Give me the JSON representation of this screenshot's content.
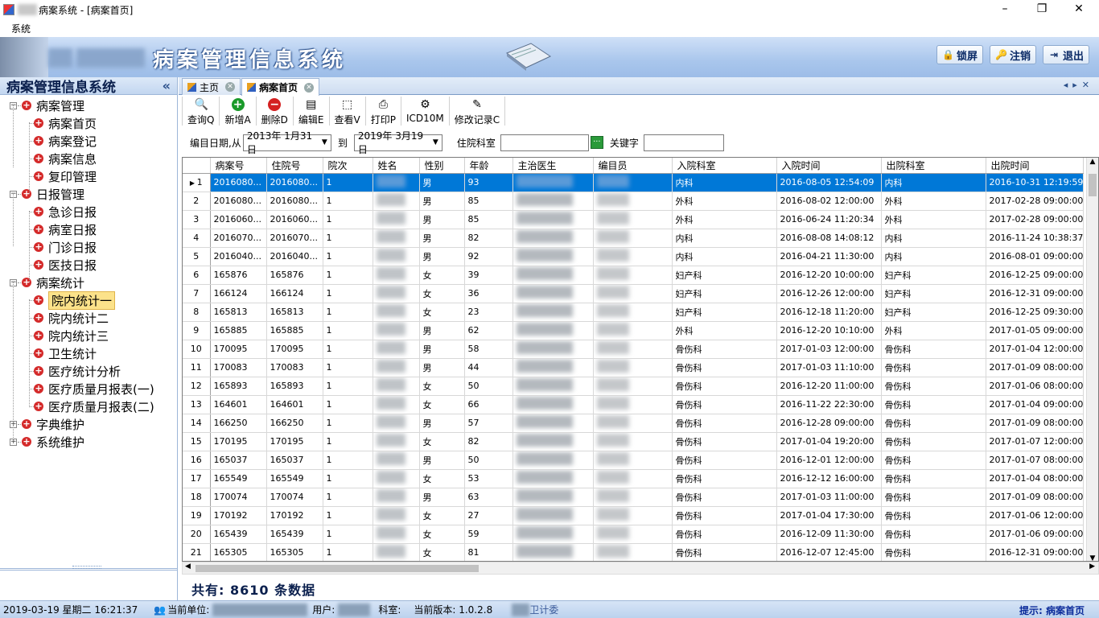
{
  "window": {
    "title": "病案系统 - [病案首页]"
  },
  "menu": [
    "系统"
  ],
  "banner": {
    "title": "病案管理信息系统",
    "buttons": [
      {
        "label": "锁屏",
        "icon": "lock-icon"
      },
      {
        "label": "注销",
        "icon": "logout-icon"
      },
      {
        "label": "退出",
        "icon": "exit-icon"
      }
    ]
  },
  "left": {
    "title": "病案管理信息系统",
    "collapse": "«",
    "tree": [
      {
        "label": "病案管理",
        "level": 0,
        "exp": "−"
      },
      {
        "label": "病案首页",
        "level": 1
      },
      {
        "label": "病案登记",
        "level": 1
      },
      {
        "label": "病案信息",
        "level": 1
      },
      {
        "label": "复印管理",
        "level": 1
      },
      {
        "label": "日报管理",
        "level": 0,
        "exp": "−"
      },
      {
        "label": "急诊日报",
        "level": 1
      },
      {
        "label": "病室日报",
        "level": 1
      },
      {
        "label": "门诊日报",
        "level": 1
      },
      {
        "label": "医技日报",
        "level": 1
      },
      {
        "label": "病案统计",
        "level": 0,
        "exp": "−"
      },
      {
        "label": "院内统计一",
        "level": 1,
        "selected": true
      },
      {
        "label": "院内统计二",
        "level": 1
      },
      {
        "label": "院内统计三",
        "level": 1
      },
      {
        "label": "卫生统计",
        "level": 1
      },
      {
        "label": "医疗统计分析",
        "level": 1
      },
      {
        "label": "医疗质量月报表(一)",
        "level": 1
      },
      {
        "label": "医疗质量月报表(二)",
        "level": 1
      },
      {
        "label": "字典维护",
        "level": 0,
        "exp": "+"
      },
      {
        "label": "系统维护",
        "level": 0,
        "exp": "+"
      }
    ]
  },
  "tabs": [
    {
      "label": "主页"
    },
    {
      "label": "病案首页",
      "active": true
    }
  ],
  "toolbar": [
    {
      "label": "查询Q",
      "icon": "search-icon"
    },
    {
      "label": "新增A",
      "icon": "add-icon"
    },
    {
      "label": "删除D",
      "icon": "delete-icon"
    },
    {
      "label": "编辑E",
      "icon": "edit-icon"
    },
    {
      "label": "查看V",
      "icon": "view-icon"
    },
    {
      "label": "打印P",
      "icon": "print-icon"
    },
    {
      "label": "ICD10M",
      "icon": "icd-icon"
    },
    {
      "label": "修改记录C",
      "icon": "history-icon"
    }
  ],
  "filter": {
    "date_label": "编目日期,从",
    "date_from": "2013年 1月31日",
    "to_label": "到",
    "date_to": "2019年 3月19日",
    "dept_label": "住院科室",
    "dept_value": "",
    "keyword_label": "关键字",
    "keyword_value": ""
  },
  "grid": {
    "columns": [
      "病案号",
      "住院号",
      "院次",
      "姓名",
      "性别",
      "年龄",
      "主治医生",
      "编目员",
      "入院科室",
      "入院时间",
      "出院科室",
      "出院时间"
    ],
    "rows": [
      [
        "1",
        "2016080...",
        "2016080...",
        "1",
        "男",
        "93",
        "内科",
        "2016-08-05 12:54:09",
        "内科",
        "2016-10-31 12:19:59"
      ],
      [
        "2",
        "2016080...",
        "2016080...",
        "1",
        "男",
        "85",
        "外科",
        "2016-08-02 12:00:00",
        "外科",
        "2017-02-28 09:00:00"
      ],
      [
        "3",
        "2016060...",
        "2016060...",
        "1",
        "男",
        "85",
        "外科",
        "2016-06-24 11:20:34",
        "外科",
        "2017-02-28 09:00:00"
      ],
      [
        "4",
        "2016070...",
        "2016070...",
        "1",
        "男",
        "82",
        "内科",
        "2016-08-08 14:08:12",
        "内科",
        "2016-11-24 10:38:37"
      ],
      [
        "5",
        "2016040...",
        "2016040...",
        "1",
        "男",
        "92",
        "内科",
        "2016-04-21 11:30:00",
        "内科",
        "2016-08-01 09:00:00"
      ],
      [
        "6",
        "165876",
        "165876",
        "1",
        "女",
        "39",
        "妇产科",
        "2016-12-20 10:00:00",
        "妇产科",
        "2016-12-25 09:00:00"
      ],
      [
        "7",
        "166124",
        "166124",
        "1",
        "女",
        "36",
        "妇产科",
        "2016-12-26 12:00:00",
        "妇产科",
        "2016-12-31 09:00:00"
      ],
      [
        "8",
        "165813",
        "165813",
        "1",
        "女",
        "23",
        "妇产科",
        "2016-12-18 11:20:00",
        "妇产科",
        "2016-12-25 09:30:00"
      ],
      [
        "9",
        "165885",
        "165885",
        "1",
        "男",
        "62",
        "外科",
        "2016-12-20 10:10:00",
        "外科",
        "2017-01-05 09:00:00"
      ],
      [
        "10",
        "170095",
        "170095",
        "1",
        "男",
        "58",
        "骨伤科",
        "2017-01-03 12:00:00",
        "骨伤科",
        "2017-01-04 12:00:00"
      ],
      [
        "11",
        "170083",
        "170083",
        "1",
        "男",
        "44",
        "骨伤科",
        "2017-01-03 11:10:00",
        "骨伤科",
        "2017-01-09 08:00:00"
      ],
      [
        "12",
        "165893",
        "165893",
        "1",
        "女",
        "50",
        "骨伤科",
        "2016-12-20 11:00:00",
        "骨伤科",
        "2017-01-06 08:00:00"
      ],
      [
        "13",
        "164601",
        "164601",
        "1",
        "女",
        "66",
        "骨伤科",
        "2016-11-22 22:30:00",
        "骨伤科",
        "2017-01-04 09:00:00"
      ],
      [
        "14",
        "166250",
        "166250",
        "1",
        "男",
        "57",
        "骨伤科",
        "2016-12-28 09:00:00",
        "骨伤科",
        "2017-01-09 08:00:00"
      ],
      [
        "15",
        "170195",
        "170195",
        "1",
        "女",
        "82",
        "骨伤科",
        "2017-01-04 19:20:00",
        "骨伤科",
        "2017-01-07 12:00:00"
      ],
      [
        "16",
        "165037",
        "165037",
        "1",
        "男",
        "50",
        "骨伤科",
        "2016-12-01 12:00:00",
        "骨伤科",
        "2017-01-07 08:00:00"
      ],
      [
        "17",
        "165549",
        "165549",
        "1",
        "女",
        "53",
        "骨伤科",
        "2016-12-12 16:00:00",
        "骨伤科",
        "2017-01-04 08:00:00"
      ],
      [
        "18",
        "170074",
        "170074",
        "1",
        "男",
        "63",
        "骨伤科",
        "2017-01-03 11:00:00",
        "骨伤科",
        "2017-01-09 08:00:00"
      ],
      [
        "19",
        "170192",
        "170192",
        "1",
        "女",
        "27",
        "骨伤科",
        "2017-01-04 17:30:00",
        "骨伤科",
        "2017-01-06 12:00:00"
      ],
      [
        "20",
        "165439",
        "165439",
        "1",
        "女",
        "59",
        "骨伤科",
        "2016-12-09 11:30:00",
        "骨伤科",
        "2017-01-06 09:00:00"
      ],
      [
        "21",
        "165305",
        "165305",
        "1",
        "女",
        "81",
        "骨伤科",
        "2016-12-07 12:45:00",
        "骨伤科",
        "2016-12-31 09:00:00"
      ]
    ]
  },
  "total": "共有: 8610 条数据",
  "status": {
    "datetime": "2019-03-19 星期二 16:21:37",
    "unit_label": "当前单位:",
    "user_label": "用户:",
    "dept_label": "科室:",
    "version": "当前版本: 1.0.2.8",
    "org": "卫计委",
    "hint": "提示: 病案首页"
  }
}
